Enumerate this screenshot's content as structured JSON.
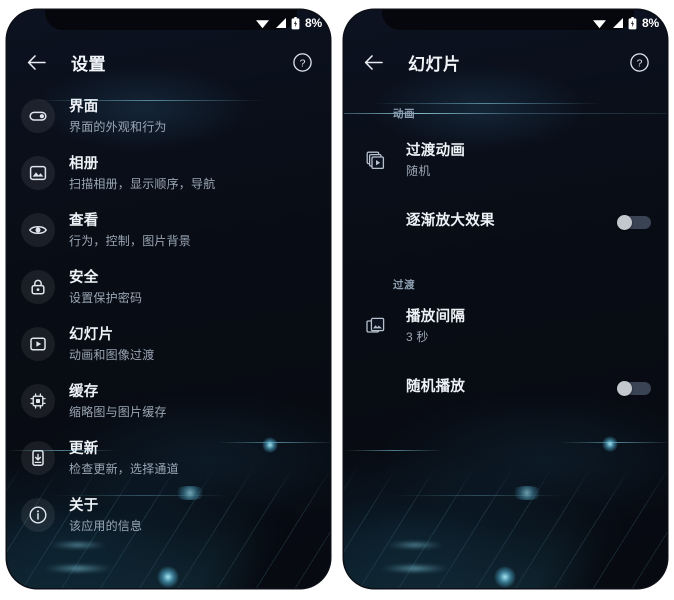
{
  "status_bar": {
    "battery_text": "8%",
    "icons": [
      "wifi-icon",
      "signal-icon",
      "battery-icon"
    ]
  },
  "left_phone": {
    "app_bar": {
      "back_label": "←",
      "title": "设置",
      "help_label": "?"
    },
    "items": [
      {
        "icon": "interface-toggle-icon",
        "title": "界面",
        "subtitle": "界面的外观和行为"
      },
      {
        "icon": "photo-album-icon",
        "title": "相册",
        "subtitle": "扫描相册，显示顺序，导航"
      },
      {
        "icon": "eye-icon",
        "title": "查看",
        "subtitle": "行为，控制，图片背景"
      },
      {
        "icon": "lock-icon",
        "title": "安全",
        "subtitle": "设置保护密码"
      },
      {
        "icon": "slideshow-icon",
        "title": "幻灯片",
        "subtitle": "动画和图像过渡"
      },
      {
        "icon": "chip-icon",
        "title": "缓存",
        "subtitle": "缩略图与图片缓存"
      },
      {
        "icon": "update-icon",
        "title": "更新",
        "subtitle": "检查更新，选择通道"
      },
      {
        "icon": "info-icon",
        "title": "关于",
        "subtitle": "该应用的信息"
      }
    ]
  },
  "right_phone": {
    "app_bar": {
      "back_label": "←",
      "title": "幻灯片",
      "help_label": "?"
    },
    "sections": [
      {
        "header": "动画",
        "items": [
          {
            "type": "value",
            "icon": "layers-icon",
            "title": "过渡动画",
            "subtitle": "随机"
          },
          {
            "type": "switch",
            "icon": "",
            "title": "逐渐放大效果",
            "subtitle": "",
            "checked": false
          }
        ]
      },
      {
        "header": "过渡",
        "items": [
          {
            "type": "value",
            "icon": "images-stack-icon",
            "title": "播放间隔",
            "subtitle": "3 秒"
          },
          {
            "type": "switch",
            "icon": "",
            "title": "随机播放",
            "subtitle": "",
            "checked": false
          }
        ]
      }
    ]
  },
  "colors": {
    "screen_bg": "#0a0e17",
    "title": "#eef2f7",
    "subtitle": "#9aa6b4",
    "accent_glow": "#9beaff",
    "switch_track": "#3a4354",
    "switch_thumb": "#c3c8cf"
  }
}
